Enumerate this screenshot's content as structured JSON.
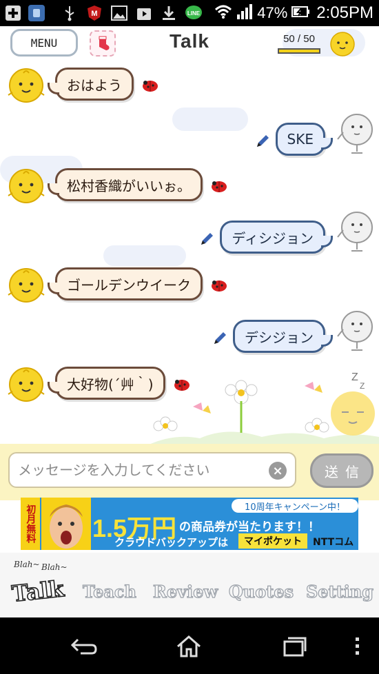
{
  "status_bar": {
    "battery": "47%",
    "time": "2:05PM"
  },
  "header": {
    "menu_label": "MENU",
    "title": "Talk",
    "counter": "50 / 50",
    "counter_fraction": 1.0
  },
  "messages": [
    {
      "from": "simi",
      "text": "おはよう"
    },
    {
      "from": "user",
      "text": "SKE"
    },
    {
      "from": "simi",
      "text": "松村香織がいいぉ。"
    },
    {
      "from": "user",
      "text": "ディシジョン"
    },
    {
      "from": "simi",
      "text": "ゴールデンウイーク"
    },
    {
      "from": "user",
      "text": "デシジョン"
    },
    {
      "from": "simi",
      "text": "大好物(´艸｀)"
    }
  ],
  "input": {
    "placeholder": "メッセージを入力してください",
    "value": "",
    "send_label": "送信"
  },
  "ad": {
    "side_text": "初月無料",
    "campaign": "10周年キャンペーン中！",
    "headline_amount": "1.5万円",
    "headline_rest": "の商品券が当たります！！",
    "tagline": "クラウドバックアップは",
    "product": "マイポケット",
    "brand": "NTTコム"
  },
  "tabs": {
    "blah1": "Blah~",
    "blah2": "Blah~",
    "talk": "Talk",
    "teach": "Teach",
    "review": "Review",
    "quotes": "Quotes",
    "setting": "Setting"
  },
  "colors": {
    "simi_bubble": "#fdf1e2",
    "user_bubble": "#e6eefc",
    "input_bar": "#fbf4c2"
  }
}
